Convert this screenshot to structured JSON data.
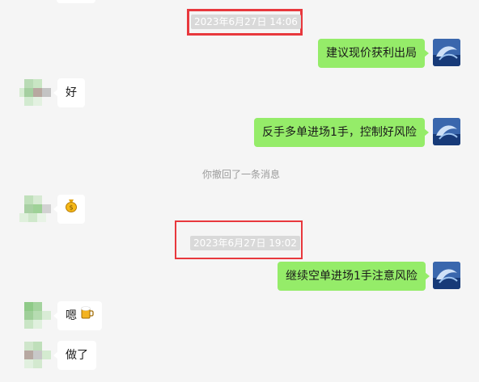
{
  "messages": {
    "m1": {
      "text": "建议现价获利出局"
    },
    "m2": {
      "text": "好"
    },
    "m3": {
      "text": "反手多单进场1手，控制好风险"
    },
    "m4": {
      "text": "继续空单进场1手注意风险"
    },
    "m5": {
      "text": "嗯"
    },
    "m6": {
      "text": "做了"
    }
  },
  "timestamps": {
    "t1": "2023年6月27日 14:06",
    "t2": "2023年6月27日 19:02"
  },
  "system": {
    "recall_notice": "你撤回了一条消息"
  },
  "icons": {
    "m2b_emoji": "money-bag-icon",
    "m5_emoji": "beer-mug-icon"
  },
  "colors": {
    "background": "#f5f5f5",
    "outgoing_bubble": "#95ec69",
    "incoming_bubble": "#ffffff",
    "highlight_frame": "#e8383d"
  }
}
